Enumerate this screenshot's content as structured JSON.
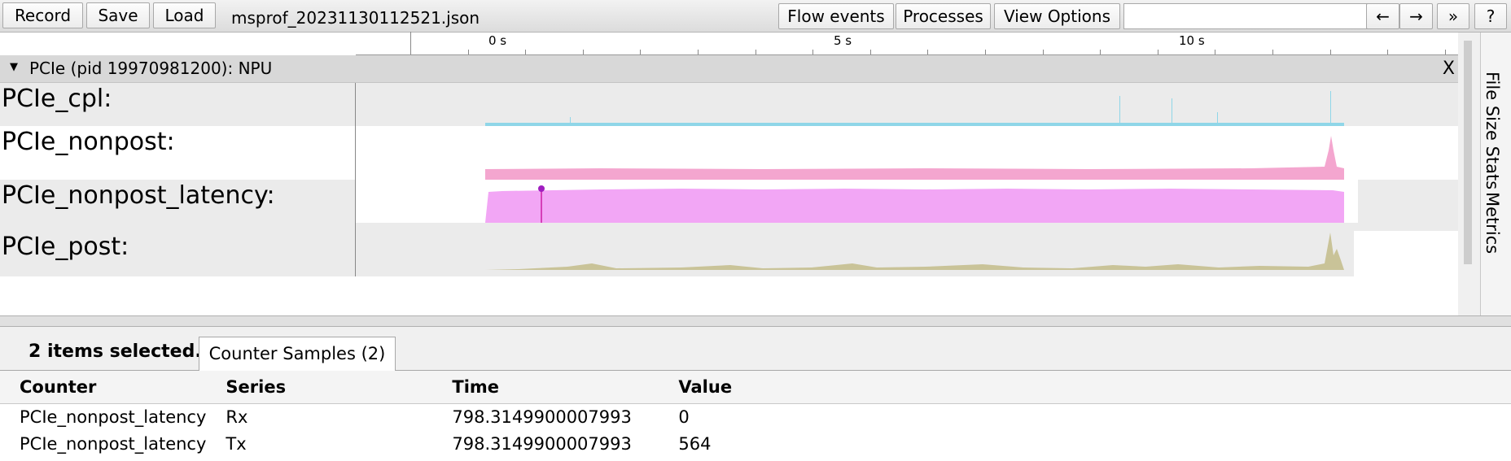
{
  "toolbar": {
    "record": "Record",
    "save": "Save",
    "load": "Load",
    "filename": "msprof_20231130112521.json",
    "flow_events": "Flow events",
    "processes": "Processes",
    "view_options": "View Options",
    "search_value": "",
    "prev": "←",
    "next": "→",
    "more": "»",
    "help": "?"
  },
  "ruler": {
    "labels": [
      "0 s",
      "5 s",
      "10 s"
    ]
  },
  "process": {
    "title": "PCIe (pid 19970981200): NPU",
    "close": "X",
    "tracks": [
      {
        "name": "PCIe_cpl:",
        "color": "#8fd6e8"
      },
      {
        "name": "PCIe_nonpost:",
        "color": "#f4a6cf"
      },
      {
        "name": "PCIe_nonpost_latency:",
        "color": "#f2a6f5"
      },
      {
        "name": "PCIe_post:",
        "color": "#c9c398"
      }
    ]
  },
  "side_tabs": {
    "file_size_stats": "File Size Stats",
    "metrics": "Metrics"
  },
  "analysis": {
    "selection": "2 items selected.",
    "tab": "Counter Samples (2)",
    "headers": [
      "Counter",
      "Series",
      "Time",
      "Value"
    ],
    "rows": [
      [
        "PCIe_nonpost_latency",
        "Rx",
        "798.3149900007993",
        "0"
      ],
      [
        "PCIe_nonpost_latency",
        "Tx",
        "798.3149900007993",
        "564"
      ]
    ]
  }
}
